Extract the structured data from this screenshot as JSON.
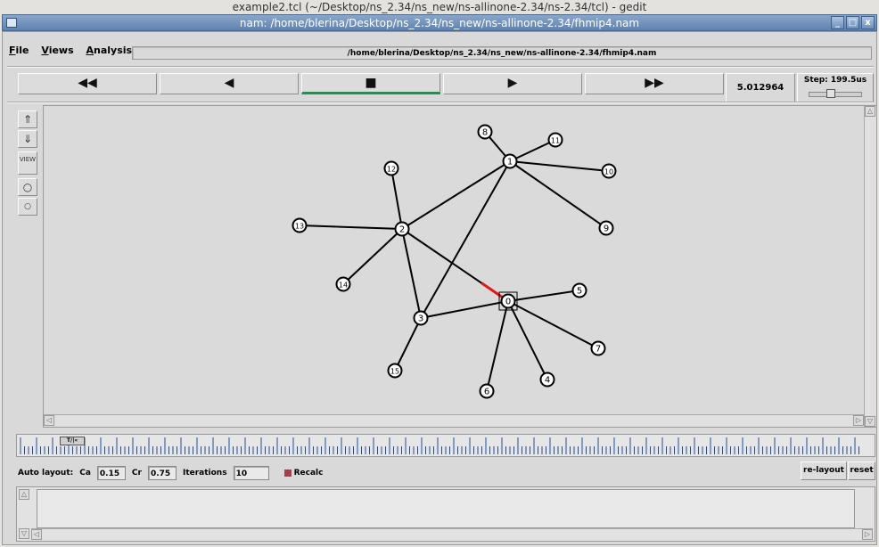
{
  "background_window": {
    "title": "example2.tcl (~/Desktop/ns_2.34/ns_new/ns-allinone-2.34/ns-2.34/tcl) - gedit"
  },
  "window": {
    "title": "nam: /home/blerina/Desktop/ns_2.34/ns_new/ns-allinone-2.34/fhmip4.nam",
    "minimize": "_",
    "maximize": "□",
    "close": "x"
  },
  "menu": {
    "file_rest": "ile",
    "file_u": "F",
    "views_u": "V",
    "views_rest": "iews",
    "analysis_u": "A",
    "analysis_rest": "nalysis"
  },
  "file_path": "/home/blerina/Desktop/ns_2.34/ns_new/ns-allinone-2.34/fhmip4.nam",
  "playback": {
    "rewind": "◀◀",
    "back": "◀",
    "stop": "■",
    "play": "▶",
    "fast_forward": "▶▶",
    "time": "5.012964",
    "step_label": "Step: 199.5us",
    "step_slider_level": 0.4
  },
  "left_tools": {
    "view_label": "VIEW"
  },
  "network": {
    "nodes": [
      {
        "id": "0"
      },
      {
        "id": "1"
      },
      {
        "id": "2"
      },
      {
        "id": "3"
      },
      {
        "id": "4"
      },
      {
        "id": "5"
      },
      {
        "id": "6"
      },
      {
        "id": "7"
      },
      {
        "id": "8"
      },
      {
        "id": "9"
      },
      {
        "id": "10"
      },
      {
        "id": "11"
      },
      {
        "id": "12"
      },
      {
        "id": "13"
      },
      {
        "id": "14"
      },
      {
        "id": "15"
      }
    ],
    "links": [
      [
        "1",
        "8"
      ],
      [
        "1",
        "11"
      ],
      [
        "1",
        "10"
      ],
      [
        "1",
        "9"
      ],
      [
        "1",
        "2"
      ],
      [
        "1",
        "3"
      ],
      [
        "2",
        "12"
      ],
      [
        "2",
        "13"
      ],
      [
        "2",
        "14"
      ],
      [
        "2",
        "3"
      ],
      [
        "2",
        "0"
      ],
      [
        "3",
        "0"
      ],
      [
        "3",
        "15"
      ],
      [
        "0",
        "5"
      ],
      [
        "0",
        "7"
      ],
      [
        "0",
        "4"
      ],
      [
        "0",
        "6"
      ]
    ],
    "active_packet": {
      "from": "2",
      "to": "0"
    },
    "packet_color": "#e01818",
    "selected_node": "0"
  },
  "timeline": {
    "handle_label": "T/|«",
    "position": 0.05
  },
  "auto_layout": {
    "label": "Auto layout:",
    "ca_label": "Ca",
    "ca_value": "0.15",
    "cr_label": "Cr",
    "cr_value": "0.75",
    "iterations_label": "Iterations",
    "iterations_value": "10",
    "recalc_label": "Recalc",
    "relayout": "re-layout",
    "reset": "reset"
  }
}
